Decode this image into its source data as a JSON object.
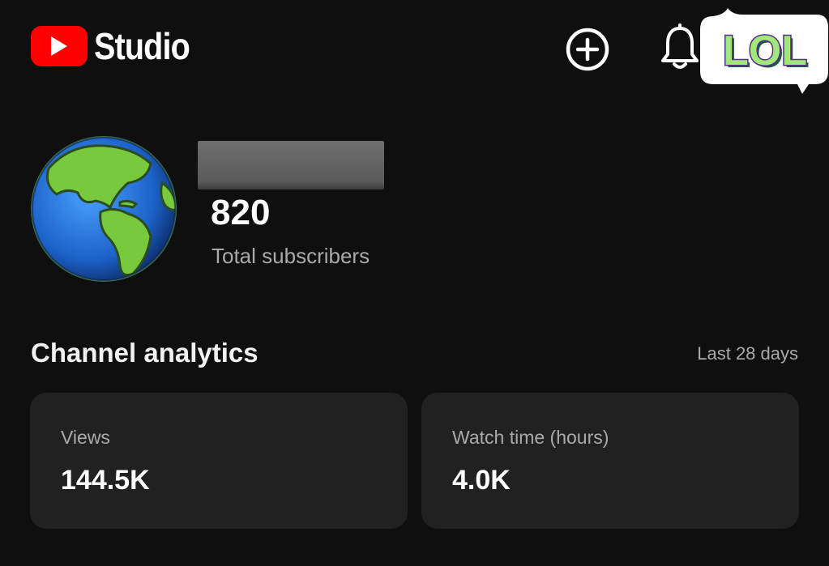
{
  "header": {
    "app_name": "Studio",
    "icons": [
      "youtube-logo-icon",
      "create-plus-icon",
      "bell-icon"
    ],
    "sticker_text": "LOL"
  },
  "channel": {
    "subscriber_count": "820",
    "subscriber_label": "Total subscribers"
  },
  "analytics": {
    "title": "Channel analytics",
    "range": "Last 28 days",
    "cards": [
      {
        "label": "Views",
        "value": "144.5K"
      },
      {
        "label": "Watch time (hours)",
        "value": "4.0K"
      }
    ]
  },
  "colors": {
    "background": "#0f0f0f",
    "card": "#212121",
    "brand_red": "#ff0000",
    "secondary_text": "#aaaaaa"
  }
}
